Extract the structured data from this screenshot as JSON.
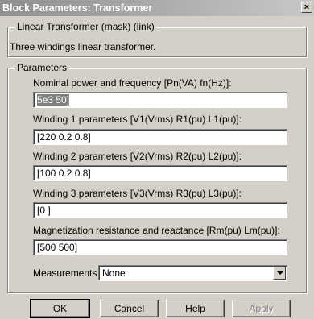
{
  "window": {
    "title": "Block Parameters: Transformer",
    "close_glyph": "×"
  },
  "description": {
    "legend": "Linear Transformer (mask) (link)",
    "text": "Three windings linear transformer."
  },
  "parameters": {
    "legend": "Parameters",
    "fields": [
      {
        "label": "Nominal power and frequency [Pn(VA) fn(Hz)]:",
        "value": "5e3 50]"
      },
      {
        "label": "Winding 1 parameters [V1(Vrms) R1(pu) L1(pu)]:",
        "value": "[220 0.2 0.8]"
      },
      {
        "label": "Winding 2 parameters [V2(Vrms) R2(pu) L2(pu)]:",
        "value": "[100 0.2 0.8]"
      },
      {
        "label": "Winding 3 parameters [V3(Vrms) R3(pu) L3(pu)]:",
        "value": "[0 ]"
      },
      {
        "label": "Magnetization resistance and reactance [Rm(pu) Lm(pu)]:",
        "value": "[500 500]"
      }
    ],
    "measurements": {
      "label": "Measurements",
      "selected": "None"
    }
  },
  "buttons": {
    "ok": "OK",
    "cancel": "Cancel",
    "help": "Help",
    "apply": "Apply"
  }
}
